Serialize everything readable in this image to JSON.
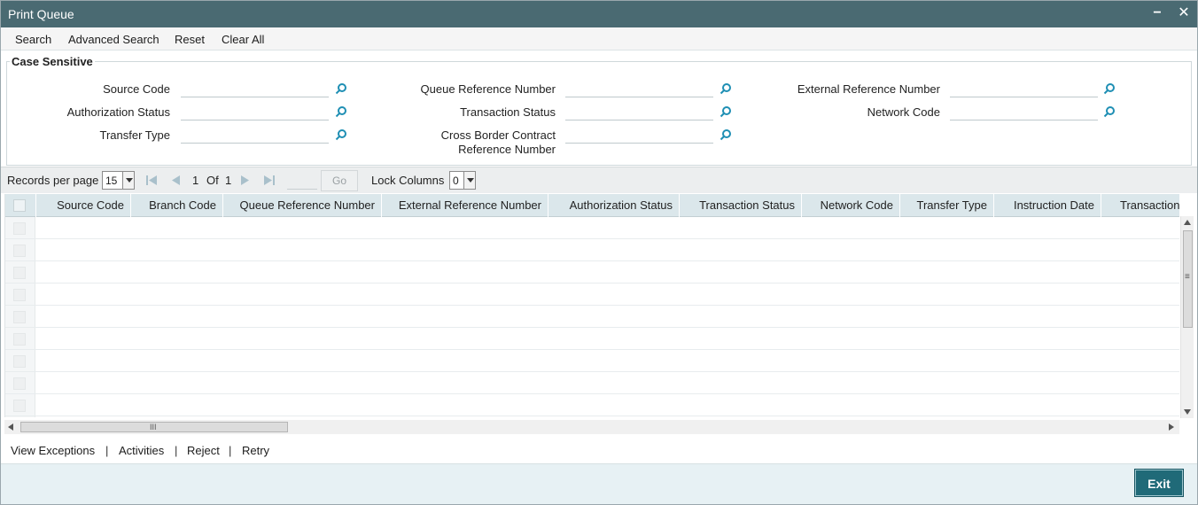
{
  "window": {
    "title": "Print Queue",
    "minimize_glyph": "−",
    "close_glyph": "✕"
  },
  "toolbar": {
    "search": "Search",
    "advanced_search": "Advanced Search",
    "reset": "Reset",
    "clear_all": "Clear All"
  },
  "criteria": {
    "legend": "Case Sensitive",
    "source_code": "Source Code",
    "authorization_status": "Authorization Status",
    "transfer_type": "Transfer Type",
    "queue_reference_number": "Queue Reference Number",
    "transaction_status": "Transaction Status",
    "cross_border_line1": "Cross Border Contract",
    "cross_border_line2": "Reference Number",
    "external_reference_number": "External Reference Number",
    "network_code": "Network Code"
  },
  "pager": {
    "records_label": "Records per page",
    "records_value": "15",
    "current_page": "1",
    "of_label": "Of",
    "total_pages": "1",
    "go": "Go",
    "lock_label": "Lock Columns",
    "lock_value": "0"
  },
  "grid": {
    "columns": [
      "Source Code",
      "Branch Code",
      "Queue Reference Number",
      "External Reference Number",
      "Authorization Status",
      "Transaction Status",
      "Network Code",
      "Transfer Type",
      "Instruction Date",
      "Transaction"
    ],
    "empty_row_count": 9,
    "hscroll_glyph": "III",
    "vscroll_glyph": "≡"
  },
  "actions": {
    "view_exceptions": "View Exceptions",
    "activities": "Activities",
    "reject": "Reject",
    "retry": "Retry",
    "separator": "|"
  },
  "footer": {
    "exit": "Exit"
  },
  "colors": {
    "titlebar": "#4a6a72",
    "grid_header": "#dbe7eb",
    "exit_button": "#206a78",
    "lookup_icon": "#1f8fb4"
  }
}
